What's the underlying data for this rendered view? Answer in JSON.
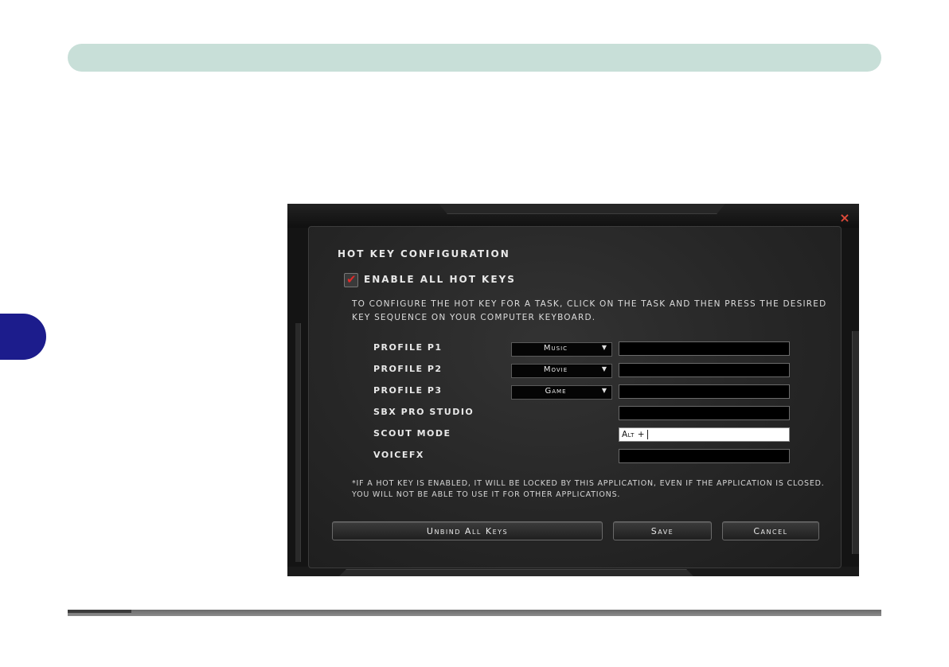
{
  "dialog": {
    "title": "HOT KEY CONFIGURATION",
    "close_icon": "×",
    "enable_label": "ENABLE ALL HOT KEYS",
    "enable_checked": true,
    "check_glyph": "✔",
    "instructions": "To configure the hot key for a task, click on the task and then press the desired key sequence on your computer keyboard.",
    "rows": [
      {
        "label": "PROFILE P1",
        "dropdown": "Music",
        "key": ""
      },
      {
        "label": "PROFILE P2",
        "dropdown": "Movie",
        "key": ""
      },
      {
        "label": "PROFILE P3",
        "dropdown": "Game",
        "key": ""
      },
      {
        "label": "SBX PRO STUDIO",
        "key": ""
      },
      {
        "label": "SCOUT MODE",
        "key": "Alt +"
      },
      {
        "label": "VOICEFX",
        "key": ""
      }
    ],
    "dropdown_arrow": "▼",
    "note": "*If a hot key is enabled, it will be locked by this application, even if the application is closed. You will not be able to use it for other applications.",
    "buttons": {
      "unbind": "Unbind All Keys",
      "save": "Save",
      "cancel": "Cancel"
    }
  },
  "colors": {
    "header_bar": "#c8dfd8",
    "side_tab": "#1c1c8c",
    "close_accent": "#e04a3a",
    "check_accent": "#e02a2a"
  }
}
